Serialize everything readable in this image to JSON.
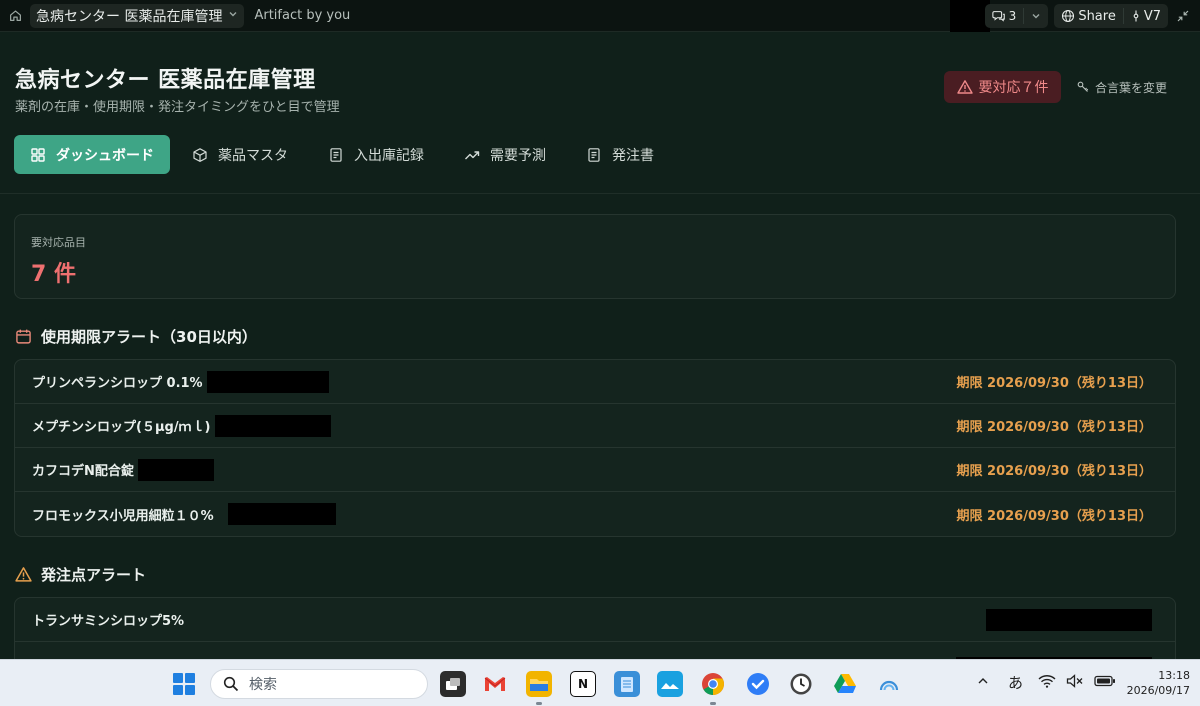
{
  "topbar": {
    "title": "急病センター 医薬品在庫管理",
    "subtitle": "Artifact by you",
    "comments_count": "3",
    "share_label": "Share",
    "version_label": "V7"
  },
  "header": {
    "title": "急病センター 医薬品在庫管理",
    "subtitle": "薬剤の在庫・使用期限・発注タイミングをひと目で管理",
    "alert_button": "要対応７件",
    "passphrase_button": "合言葉を変更"
  },
  "tabs": [
    {
      "label": "ダッシュボード",
      "icon": "dashboard-icon",
      "active": true
    },
    {
      "label": "薬品マスタ",
      "icon": "cube-icon",
      "active": false
    },
    {
      "label": "入出庫記録",
      "icon": "document-icon",
      "active": false
    },
    {
      "label": "需要予測",
      "icon": "trend-icon",
      "active": false
    },
    {
      "label": "発注書",
      "icon": "document-icon",
      "active": false
    }
  ],
  "summary": {
    "label": "要対応品目",
    "value": "7 件"
  },
  "expiry_section": {
    "title": "使用期限アラート（30日以内）",
    "items": [
      {
        "name": "プリンペランシロップ 0.1%",
        "expiry": "期限 2026/09/30（残り13日）"
      },
      {
        "name": "メプチンシロップ(５μg/ｍｌ)",
        "expiry": "期限 2026/09/30（残り13日）"
      },
      {
        "name": "カフコデN配合錠",
        "expiry": "期限 2026/09/30（残り13日）"
      },
      {
        "name": "フロモックス小児用細粒１０%",
        "expiry": "期限 2026/09/30（残り13日）"
      }
    ]
  },
  "reorder_section": {
    "title": "発注点アラート",
    "items": [
      {
        "name": "トランサミンシロップ5%"
      }
    ]
  },
  "taskbar": {
    "search_placeholder": "検索",
    "ime": "あ",
    "time": "13:18",
    "date": "2026/09/17"
  },
  "colors": {
    "accent": "#3ea586",
    "danger": "#ee7070",
    "warning": "#e7a04e",
    "background": "#10201a"
  }
}
